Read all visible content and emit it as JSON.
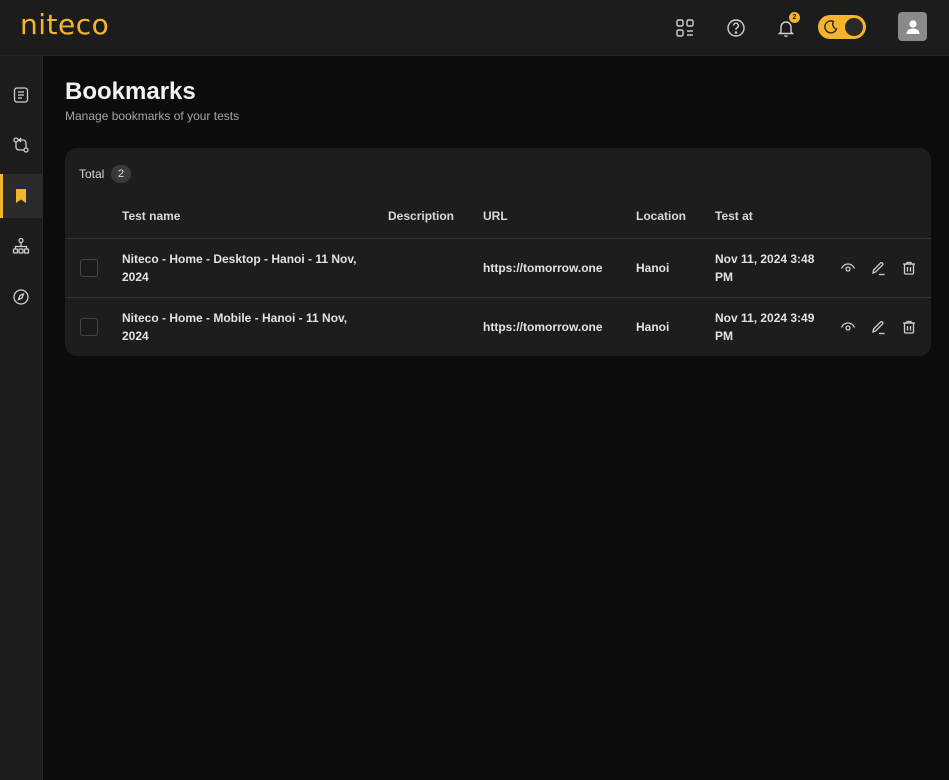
{
  "app": {
    "logo": "niteco"
  },
  "topbar": {
    "notifications_count": "2",
    "icons": [
      "apps-icon",
      "help-icon",
      "bell-icon",
      "moon-icon",
      "user-icon"
    ]
  },
  "sidebar": {
    "items": [
      {
        "name": "reports",
        "icon": "document-list-icon"
      },
      {
        "name": "compare",
        "icon": "git-compare-icon"
      },
      {
        "name": "bookmarks",
        "icon": "bookmark-icon",
        "active": true
      },
      {
        "name": "sitemap",
        "icon": "sitemap-icon"
      },
      {
        "name": "explore",
        "icon": "compass-icon"
      }
    ]
  },
  "page": {
    "title": "Bookmarks",
    "subtitle": "Manage bookmarks of your tests"
  },
  "table": {
    "total_label": "Total",
    "total_count": "2",
    "headers": {
      "test_name": "Test name",
      "description": "Description",
      "url": "URL",
      "location": "Location",
      "test_at": "Test at"
    },
    "rows": [
      {
        "test_name": "Niteco - Home - Desktop - Hanoi - 11 Nov, 2024",
        "description": "",
        "url": "https://tomorrow.one",
        "location": "Hanoi",
        "test_at": "Nov 11, 2024 3:48 PM"
      },
      {
        "test_name": "Niteco - Home - Mobile - Hanoi - 11 Nov, 2024",
        "description": "",
        "url": "https://tomorrow.one",
        "location": "Hanoi",
        "test_at": "Nov 11, 2024 3:49 PM"
      }
    ]
  },
  "colors": {
    "accent": "#f5b52a",
    "background": "#0c0c0c",
    "surface": "#1d1d1d"
  }
}
